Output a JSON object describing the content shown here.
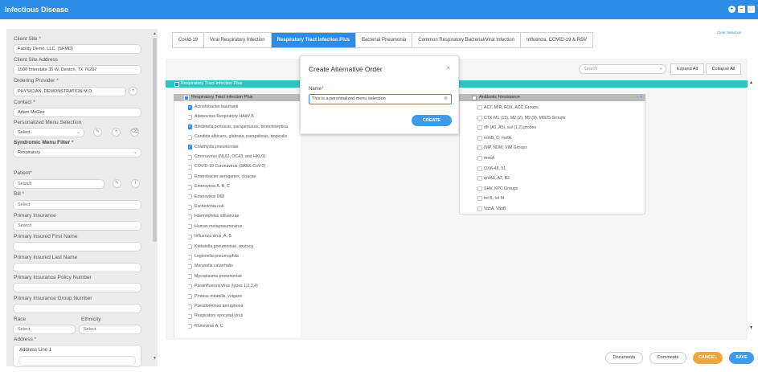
{
  "header": {
    "title": "Infectious Disease",
    "icons": [
      "add-icon",
      "minimize-icon",
      "maximize-icon"
    ]
  },
  "left": {
    "client_site_label": "Client Site",
    "client_site_value": "Facility Demo, LLC. (SFMD)",
    "client_site_address_label": "Client Site Address",
    "client_site_address_value": "1500 Interstate 35 W, Denton, TX 76207",
    "ordering_provider_label": "Ordering Provider",
    "ordering_provider_value": "PHYSICIAN, DEMONSTRATION M.D.",
    "contact_label": "Contact",
    "contact_value": "Adam McGee",
    "personalized_menu_label": "Personalized Menu Selection",
    "personalized_menu_value": "Select",
    "syndromic_label": "Syndromic Menu Filter",
    "syndromic_value": "Respiratory",
    "patient_label": "Patient",
    "patient_placeholder": "Search",
    "bill_label": "Bill",
    "bill_value": "Select",
    "primary_insurance_label": "Primary Insurance",
    "primary_insurance_placeholder": "Search",
    "insured_first_label": "Primary Insured First Name",
    "insured_last_label": "Primary Insured Last Name",
    "policy_label": "Primary Insurance Policy Number",
    "group_label": "Primary Insurance Group Number",
    "race_label": "Race",
    "race_value": "Select",
    "ethnicity_label": "Ethnicity",
    "ethnicity_value": "Select",
    "address_label": "Address",
    "address_line1": "Address Line 1"
  },
  "tabs": [
    {
      "label": "Covid-19",
      "active": false
    },
    {
      "label": "Viral Respiratory Infection",
      "active": false
    },
    {
      "label": "Respiratory Tract Infection Plus",
      "active": true
    },
    {
      "label": "Bacterial Pneumonia",
      "active": false
    },
    {
      "label": "Common Respiratory Bacterial/Viral Infection",
      "active": false
    },
    {
      "label": "Influenza, COVID-19 & RSV",
      "active": false
    }
  ],
  "view_selection": "Clear Selection",
  "toolbar": {
    "search_placeholder": "Search",
    "expand_all": "Expand All",
    "collapse_all": "Collapse All"
  },
  "section_title": "Respiratory Tract Infection Plus",
  "pathogen_header": "Respiratory Tract Infection Plus",
  "pathogens": [
    {
      "label": "Acinetobacter baumanii",
      "checked": true
    },
    {
      "label": "Adenovirus Respiratory HAdV B",
      "checked": false
    },
    {
      "label": "Bordetella pertussis, parapertussis, bronchiseptica",
      "checked": true
    },
    {
      "label": "Candida albicans, glabrata, parapsilosis, tropicalis",
      "checked": false
    },
    {
      "label": "Chlamydia pneumoniae",
      "checked": true
    },
    {
      "label": "Coronavirus (NL63, OC43, and HKU1)",
      "checked": false
    },
    {
      "label": "COVID-19 Coronavirus (SARS-CoV-2)",
      "checked": false
    },
    {
      "label": "Enterobacter aerogenes, cloacae",
      "checked": false
    },
    {
      "label": "Enterovirus A, B, C",
      "checked": false
    },
    {
      "label": "Enterovirus D68",
      "checked": false
    },
    {
      "label": "Escherichia coli",
      "checked": false
    },
    {
      "label": "Haemophilus influenzae",
      "checked": false
    },
    {
      "label": "Human metapneumovirus",
      "checked": false
    },
    {
      "label": "Influenza virus, A, B",
      "checked": false
    },
    {
      "label": "Klebsiella pneumoniae, oxytoca",
      "checked": false
    },
    {
      "label": "Legionella pneumophila",
      "checked": false
    },
    {
      "label": "Moraxella catarrhalis",
      "checked": false
    },
    {
      "label": "Mycoplasma pneumoniae",
      "checked": false
    },
    {
      "label": "Parainfluenza virus (types 1,2,3,4)",
      "checked": false
    },
    {
      "label": "Proteus mirabilis, vulgaris",
      "checked": false
    },
    {
      "label": "Pseudomonas aeruginosa",
      "checked": false
    },
    {
      "label": "Respiratory syncytial virus",
      "checked": false
    },
    {
      "label": "Rhinovirus A, C",
      "checked": false
    }
  ],
  "antibiotic_header": "Antibiotic Resistance",
  "antibiotic_controls": "− +",
  "antibiotics": [
    "ACT, MIR, FOX, ACC Groups",
    "CTX-M1 (15), M2 (2), M9 (9), M8/25 Groups",
    "dfr (A1, A5), sul (1,2) probes",
    "ermB, C; mefA",
    "IMP, NDM, VIM Groups",
    "mecA",
    "OXA-48, 51",
    "qnrA1, A2, B2",
    "SHV, KPC Groups",
    "tet B, tet M",
    "VanA, VanB"
  ],
  "modal": {
    "title": "Create Alternative Order",
    "name_label": "Name",
    "name_value": "This is a personalized menu selection",
    "create_label": "CREATE"
  },
  "footer": {
    "documents": "Documents",
    "comments": "Comments",
    "cancel": "CANCEL",
    "save": "SAVE"
  },
  "colors": {
    "primary": "#2d8ce3",
    "teal": "#33c3c3",
    "cancel": "#f0a640"
  }
}
